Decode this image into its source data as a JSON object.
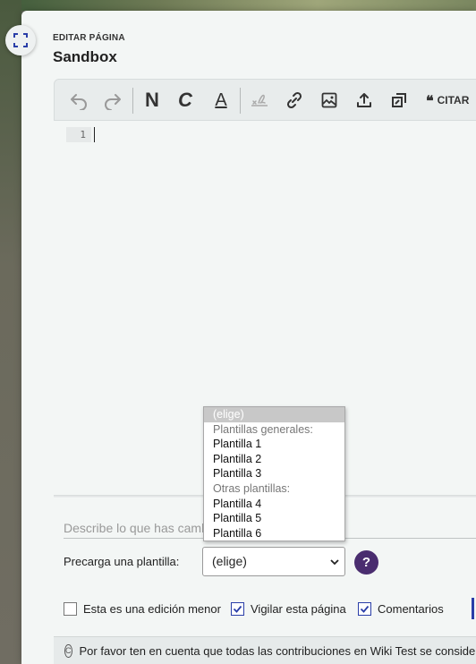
{
  "header": {
    "label": "EDITAR PÁGINA",
    "title": "Sandbox"
  },
  "toolbar": {
    "buttons": [
      {
        "name": "undo",
        "icon": "undo-icon"
      },
      {
        "name": "redo",
        "icon": "redo-icon"
      },
      {
        "name": "bold",
        "label": "N"
      },
      {
        "name": "italic",
        "label": "C"
      },
      {
        "name": "underline",
        "label": "A"
      },
      {
        "name": "signature",
        "icon": "signature-icon"
      },
      {
        "name": "link",
        "icon": "link-icon"
      },
      {
        "name": "image",
        "icon": "image-icon"
      },
      {
        "name": "upload",
        "icon": "upload-icon"
      },
      {
        "name": "template",
        "icon": "template-icon"
      }
    ],
    "cite_label": "CITAR"
  },
  "editor": {
    "line_number": "1",
    "content": ""
  },
  "summary": {
    "placeholder": "Describe lo que has cambiado"
  },
  "template": {
    "label": "Precarga una plantilla:",
    "selected": "(elige)",
    "options": [
      {
        "label": "(elige)",
        "kind": "selected"
      },
      {
        "label": "Plantillas generales:",
        "kind": "group"
      },
      {
        "label": "Plantilla 1",
        "kind": "opt"
      },
      {
        "label": "Plantilla 2",
        "kind": "opt"
      },
      {
        "label": "Plantilla 3",
        "kind": "opt"
      },
      {
        "label": "Otras plantillas:",
        "kind": "group"
      },
      {
        "label": "Plantilla 4",
        "kind": "opt"
      },
      {
        "label": "Plantilla 5",
        "kind": "opt"
      },
      {
        "label": "Plantilla 6",
        "kind": "opt"
      }
    ],
    "help": "?"
  },
  "checkboxes": {
    "minor": {
      "label": "Esta es una edición menor",
      "checked": false
    },
    "watch": {
      "label": "Vigilar esta página",
      "checked": true
    },
    "comments": {
      "label": "Comentarios",
      "checked": true
    }
  },
  "notice": {
    "text": "Por favor ten en cuenta que todas las contribuciones en Wiki Test se considerar"
  },
  "colors": {
    "accent": "#2a3ea8",
    "help_bg": "#4a2d6f",
    "panel_bg": "#f3f6f5"
  }
}
